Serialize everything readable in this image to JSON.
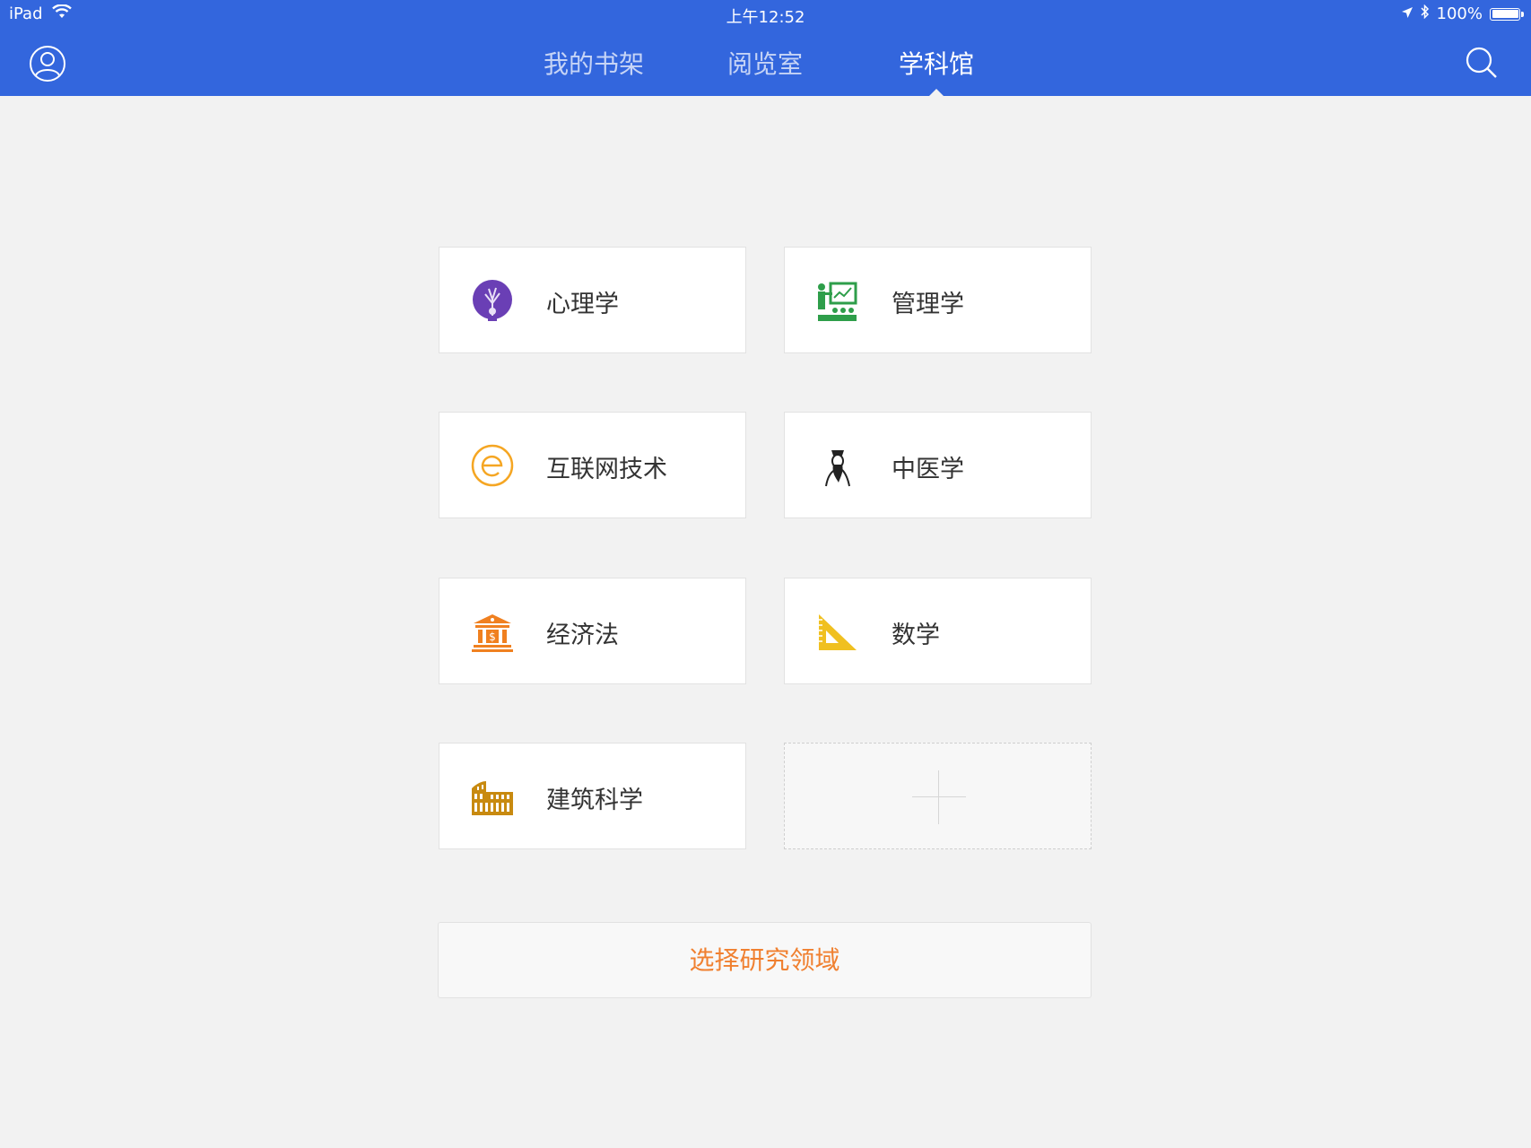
{
  "status_bar": {
    "device": "iPad",
    "time": "上午12:52",
    "battery": "100%"
  },
  "nav": {
    "tabs": [
      {
        "label": "我的书架",
        "active": false
      },
      {
        "label": "阅览室",
        "active": false
      },
      {
        "label": "学科馆",
        "active": true
      }
    ],
    "avatar_icon": "user-circle-icon",
    "search_icon": "search-icon"
  },
  "subjects": [
    {
      "label": "心理学",
      "icon": "psychology-tree-head-icon",
      "color": "#6a3fb5"
    },
    {
      "label": "管理学",
      "icon": "presentation-board-icon",
      "color": "#2e9e4a"
    },
    {
      "label": "互联网技术",
      "icon": "letter-e-circle-icon",
      "color": "#f5a623"
    },
    {
      "label": "中医学",
      "icon": "physician-portrait-icon",
      "color": "#222222"
    },
    {
      "label": "经济法",
      "icon": "bank-building-icon",
      "color": "#f08020"
    },
    {
      "label": "数学",
      "icon": "set-square-ruler-icon",
      "color": "#f0c020"
    },
    {
      "label": "建筑科学",
      "icon": "colosseum-icon",
      "color": "#c88a10"
    }
  ],
  "add_card_icon": "plus-icon",
  "select_button": {
    "label": "选择研究领域",
    "color": "#f08030"
  },
  "colors": {
    "nav_bar": "#3366dd",
    "background": "#f2f2f2"
  }
}
